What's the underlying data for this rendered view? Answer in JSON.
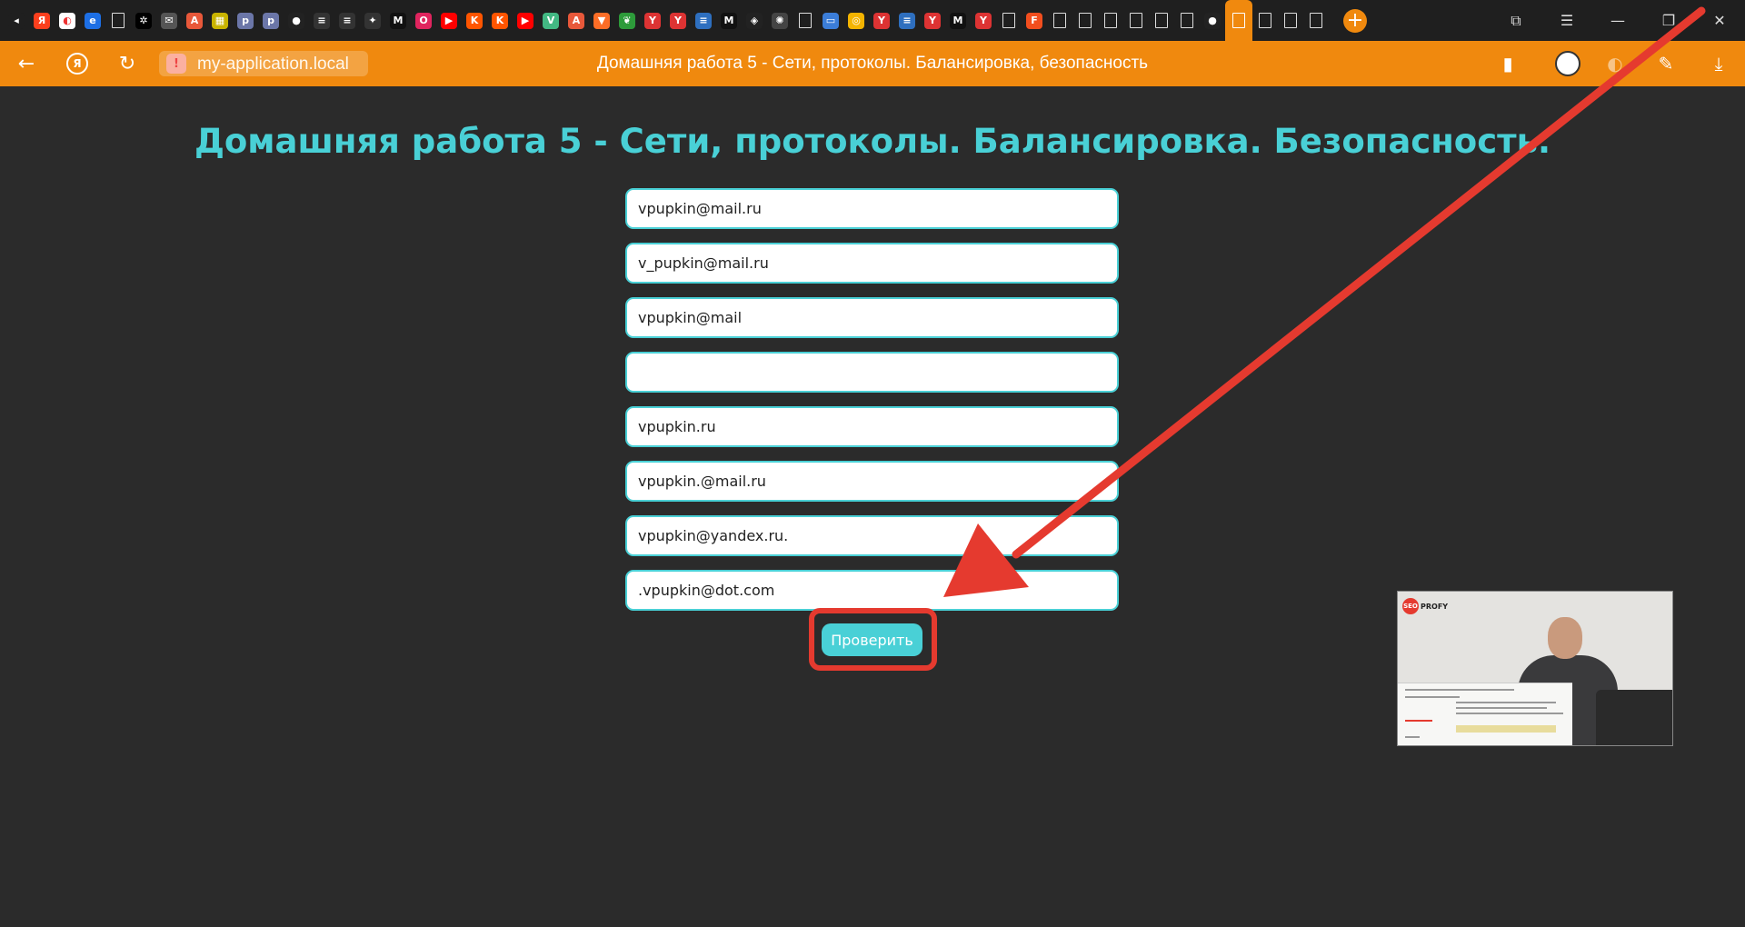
{
  "browser": {
    "tab_favicons": [
      "speaker-icon",
      "yandex-icon",
      "yandex-music-icon",
      "edge-icon",
      "doc-icon",
      "chatgpt-icon",
      "mail-icon",
      "translate-icon",
      "grid-icon",
      "php-icon",
      "php-icon",
      "github-icon",
      "stackoverflow-icon",
      "stackoverflow-icon",
      "star-icon",
      "m-icon",
      "opera-icon",
      "youtube-icon",
      "kinopoisk-icon",
      "kinopoisk-icon",
      "youtube-icon",
      "vue-icon",
      "translate-icon",
      "gitlab-icon",
      "leaf-icon",
      "tree-icon",
      "tree-icon",
      "stack-icon",
      "m-icon",
      "codepen-icon",
      "settings-icon",
      "doc-icon",
      "book-icon",
      "chrome-icon",
      "tree-icon",
      "stack-icon",
      "tree-icon",
      "m-icon",
      "tree-icon",
      "doc-icon",
      "figma-icon",
      "doc-icon",
      "doc-icon",
      "doc-icon",
      "doc-icon",
      "doc-icon",
      "doc-icon",
      "github-icon",
      "doc-icon",
      "doc-icon",
      "doc-icon",
      "doc-icon"
    ],
    "active_tab_index": 48,
    "url": "my-application.local",
    "page_title": "Домашняя работа 5 - Сети, протоколы. Балансировка, безопасность",
    "accent_color": "#f0890e"
  },
  "page": {
    "heading": "Домашняя работа 5 - Сети, протоколы. Балансировка. Безопасность.",
    "fields": [
      {
        "value": "vpupkin@mail.ru"
      },
      {
        "value": "v_pupkin@mail.ru"
      },
      {
        "value": "vpupkin@mail"
      },
      {
        "value": ""
      },
      {
        "value": "vpupkin.ru"
      },
      {
        "value": "vpupkin.@mail.ru"
      },
      {
        "value": "vpupkin@yandex.ru."
      },
      {
        "value": ".vpupkin@dot.com"
      }
    ],
    "submit_label": "Проверить",
    "heading_color": "#49d0d6",
    "background_color": "#2b2b2b"
  },
  "annotation": {
    "color": "#e53a2f"
  },
  "webcam": {
    "logo_text": "PROFY",
    "logo_badge": "SEO"
  }
}
